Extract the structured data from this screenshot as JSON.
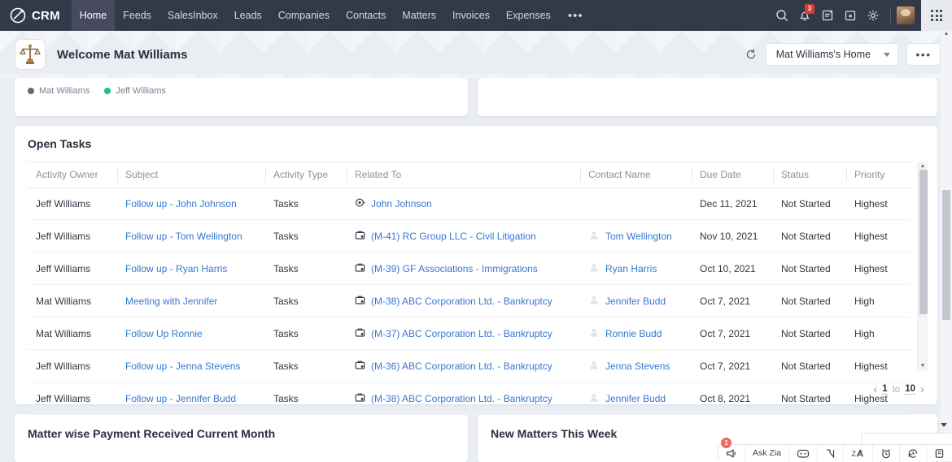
{
  "topnav": {
    "brand": "CRM",
    "items": [
      {
        "label": "Home",
        "active": true
      },
      {
        "label": "Feeds",
        "active": false
      },
      {
        "label": "SalesInbox",
        "active": false
      },
      {
        "label": "Leads",
        "active": false
      },
      {
        "label": "Companies",
        "active": false
      },
      {
        "label": "Contacts",
        "active": false
      },
      {
        "label": "Matters",
        "active": false
      },
      {
        "label": "Invoices",
        "active": false
      },
      {
        "label": "Expenses",
        "active": false
      }
    ],
    "more_label": "•••",
    "notification_count": "3"
  },
  "header": {
    "title": "Welcome Mat Williams",
    "home_select": "Mat Williams's Home",
    "more_label": "•••"
  },
  "legend_widget": {
    "items": [
      {
        "label": "Mat Williams",
        "color": "#64697a"
      },
      {
        "label": "Jeff Williams",
        "color": "#1bbf8a"
      }
    ]
  },
  "open_tasks": {
    "title": "Open Tasks",
    "columns": [
      "Activity Owner",
      "Subject",
      "Activity Type",
      "Related To",
      "Contact Name",
      "Due Date",
      "Status",
      "Priority"
    ],
    "rows": [
      {
        "owner": "Jeff Williams",
        "subject": "Follow up - John Johnson",
        "activity_type": "Tasks",
        "related_to": "John Johnson",
        "related_icon": "contact-target-icon",
        "contact": "",
        "due_date": "Dec 11, 2021",
        "status": "Not Started",
        "priority": "Highest"
      },
      {
        "owner": "Jeff Williams",
        "subject": "Follow up - Tom Wellington",
        "activity_type": "Tasks",
        "related_to": "(M-41) RC Group LLC - Civil Litigation",
        "related_icon": "portfolio-icon",
        "contact": "Tom Wellington",
        "due_date": "Nov 10, 2021",
        "status": "Not Started",
        "priority": "Highest"
      },
      {
        "owner": "Jeff Williams",
        "subject": "Follow up - Ryan Harris",
        "activity_type": "Tasks",
        "related_to": "(M-39) GF Associations - Immigrations",
        "related_icon": "portfolio-icon",
        "contact": "Ryan Harris",
        "due_date": "Oct 10, 2021",
        "status": "Not Started",
        "priority": "Highest"
      },
      {
        "owner": "Mat Williams",
        "subject": "Meeting with Jennifer",
        "activity_type": "Tasks",
        "related_to": "(M-38) ABC Corporation Ltd. - Bankruptcy",
        "related_icon": "portfolio-icon",
        "contact": "Jennifer Budd",
        "due_date": "Oct 7, 2021",
        "status": "Not Started",
        "priority": "High"
      },
      {
        "owner": "Mat Williams",
        "subject": "Follow Up Ronnie",
        "activity_type": "Tasks",
        "related_to": "(M-37) ABC Corporation Ltd. - Bankruptcy",
        "related_icon": "portfolio-icon",
        "contact": "Ronnie Budd",
        "due_date": "Oct 7, 2021",
        "status": "Not Started",
        "priority": "High"
      },
      {
        "owner": "Jeff Williams",
        "subject": "Follow up - Jenna Stevens",
        "activity_type": "Tasks",
        "related_to": "(M-36) ABC Corporation Ltd. - Bankruptcy",
        "related_icon": "portfolio-icon",
        "contact": "Jenna Stevens",
        "due_date": "Oct 7, 2021",
        "status": "Not Started",
        "priority": "Highest"
      },
      {
        "owner": "Jeff Williams",
        "subject": "Follow up - Jennifer Budd",
        "activity_type": "Tasks",
        "related_to": "(M-38) ABC Corporation Ltd. - Bankruptcy",
        "related_icon": "portfolio-icon",
        "contact": "Jennifer Budd",
        "due_date": "Oct 8, 2021",
        "status": "Not Started",
        "priority": "Highest"
      }
    ],
    "pagination": {
      "from": "1",
      "connector": "to",
      "to": "10",
      "prev": "‹",
      "next": "›"
    }
  },
  "bottom_widgets": {
    "left_title": "Matter wise Payment Received Current Month",
    "right_title": "New Matters This Week"
  },
  "bottombar": {
    "announce_badge": "1",
    "ask_zia": "Ask Zia",
    "items": [
      {
        "name": "announcement-icon"
      },
      {
        "name": "chat-bot-icon"
      },
      {
        "name": "share-cursor-icon"
      },
      {
        "name": "zia-voice-icon"
      },
      {
        "name": "alarm-clock-icon"
      },
      {
        "name": "recent-history-icon"
      },
      {
        "name": "notes-icon"
      }
    ]
  },
  "colors": {
    "nav_bg": "#323949",
    "link": "#3877d0",
    "accent_green": "#1bbf8a",
    "badge_red": "#e03a34"
  }
}
